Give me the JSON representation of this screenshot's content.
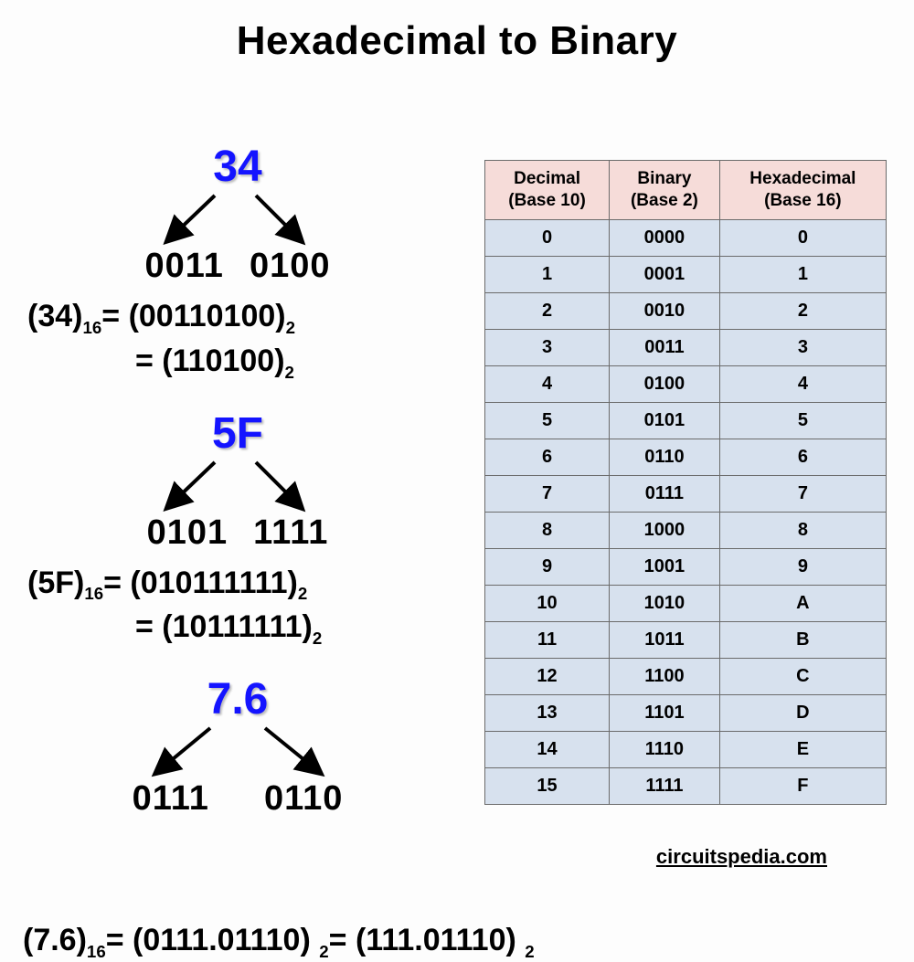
{
  "title": "Hexadecimal to Binary",
  "examples": {
    "ex1": {
      "hex": "34",
      "left_bits": "0011",
      "right_bits": "0100",
      "line1_lhs": "(34)",
      "line1_lhs_base": "16",
      "line1_rhs": "= (00110100)",
      "line1_rhs_base": "2",
      "line2": "= (110100)",
      "line2_base": "2"
    },
    "ex2": {
      "hex": "5F",
      "left_bits": "0101",
      "right_bits": "1111",
      "line1_lhs": "(5F)",
      "line1_lhs_base": "16",
      "line1_rhs": "= (010111111)",
      "line1_rhs_base": "2",
      "line2": "= (10111111)",
      "line2_base": "2"
    },
    "ex3": {
      "hex": "7.6",
      "left_bits": "0111",
      "right_bits": "0110",
      "lhs": "(7.6)",
      "lhs_base": "16",
      "mid": "= (0111.01110)",
      "mid_base": "2",
      "rhs": "= (111.01110)",
      "rhs_base": "2"
    }
  },
  "table": {
    "headers": {
      "dec1": "Decimal",
      "dec2": "(Base 10)",
      "bin1": "Binary",
      "bin2": "(Base 2)",
      "hex1": "Hexadecimal",
      "hex2": "(Base 16)"
    },
    "rows": [
      {
        "d": "0",
        "b": "0000",
        "h": "0"
      },
      {
        "d": "1",
        "b": "0001",
        "h": "1"
      },
      {
        "d": "2",
        "b": "0010",
        "h": "2"
      },
      {
        "d": "3",
        "b": "0011",
        "h": "3"
      },
      {
        "d": "4",
        "b": "0100",
        "h": "4"
      },
      {
        "d": "5",
        "b": "0101",
        "h": "5"
      },
      {
        "d": "6",
        "b": "0110",
        "h": "6"
      },
      {
        "d": "7",
        "b": "0111",
        "h": "7"
      },
      {
        "d": "8",
        "b": "1000",
        "h": "8"
      },
      {
        "d": "9",
        "b": "1001",
        "h": "9"
      },
      {
        "d": "10",
        "b": "1010",
        "h": "A"
      },
      {
        "d": "11",
        "b": "1011",
        "h": "B"
      },
      {
        "d": "12",
        "b": "1100",
        "h": "C"
      },
      {
        "d": "13",
        "b": "1101",
        "h": "D"
      },
      {
        "d": "14",
        "b": "1110",
        "h": "E"
      },
      {
        "d": "15",
        "b": "1111",
        "h": "F"
      }
    ]
  },
  "attribution": "circuitspedia.com"
}
